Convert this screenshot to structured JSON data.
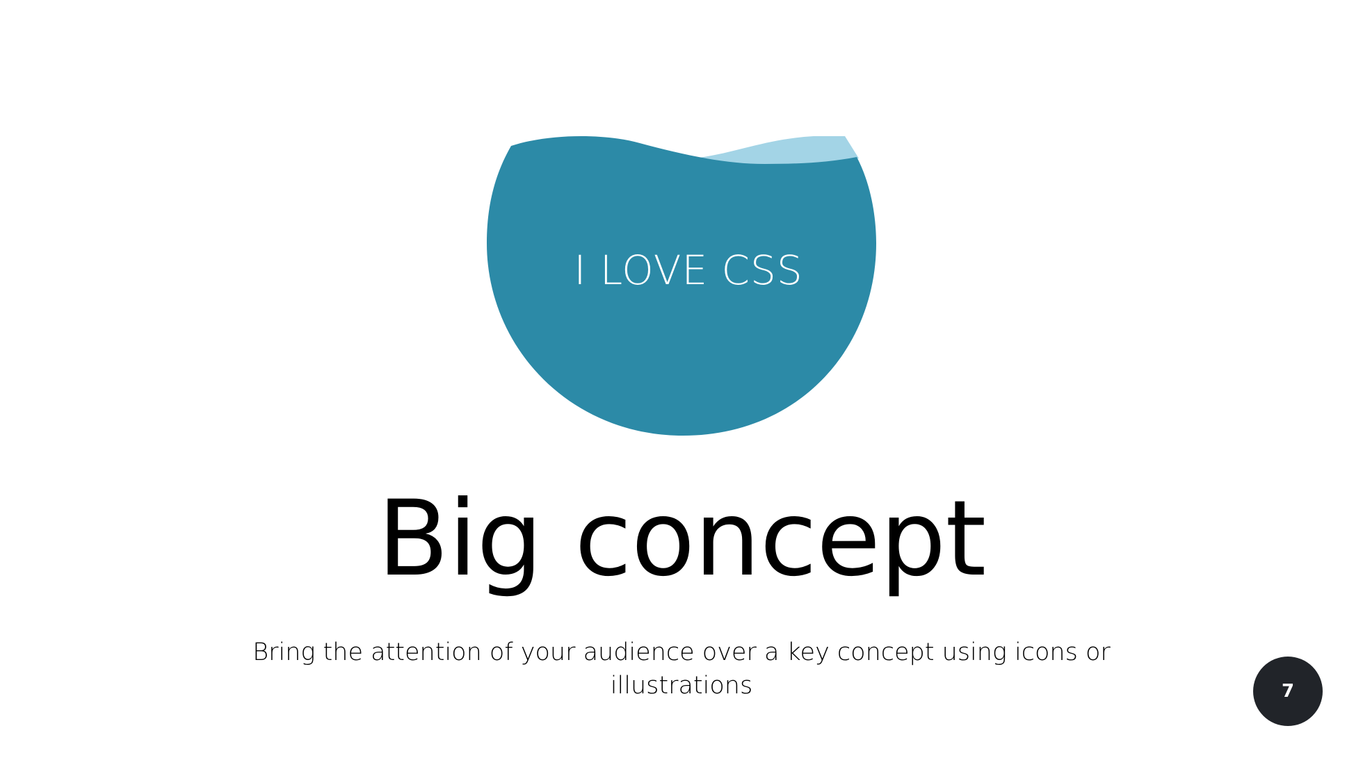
{
  "slide": {
    "blob_text": "I LOVE CSS",
    "title": "Big concept",
    "subtitle": "Bring the attention of your audience over a key concept using icons or illustrations",
    "page_number": "7"
  },
  "colors": {
    "blob_primary": "#2C8AA7",
    "blob_highlight": "#A3D4E6",
    "badge_background": "#212429",
    "text": "#000000",
    "background": "#FFFFFF"
  }
}
